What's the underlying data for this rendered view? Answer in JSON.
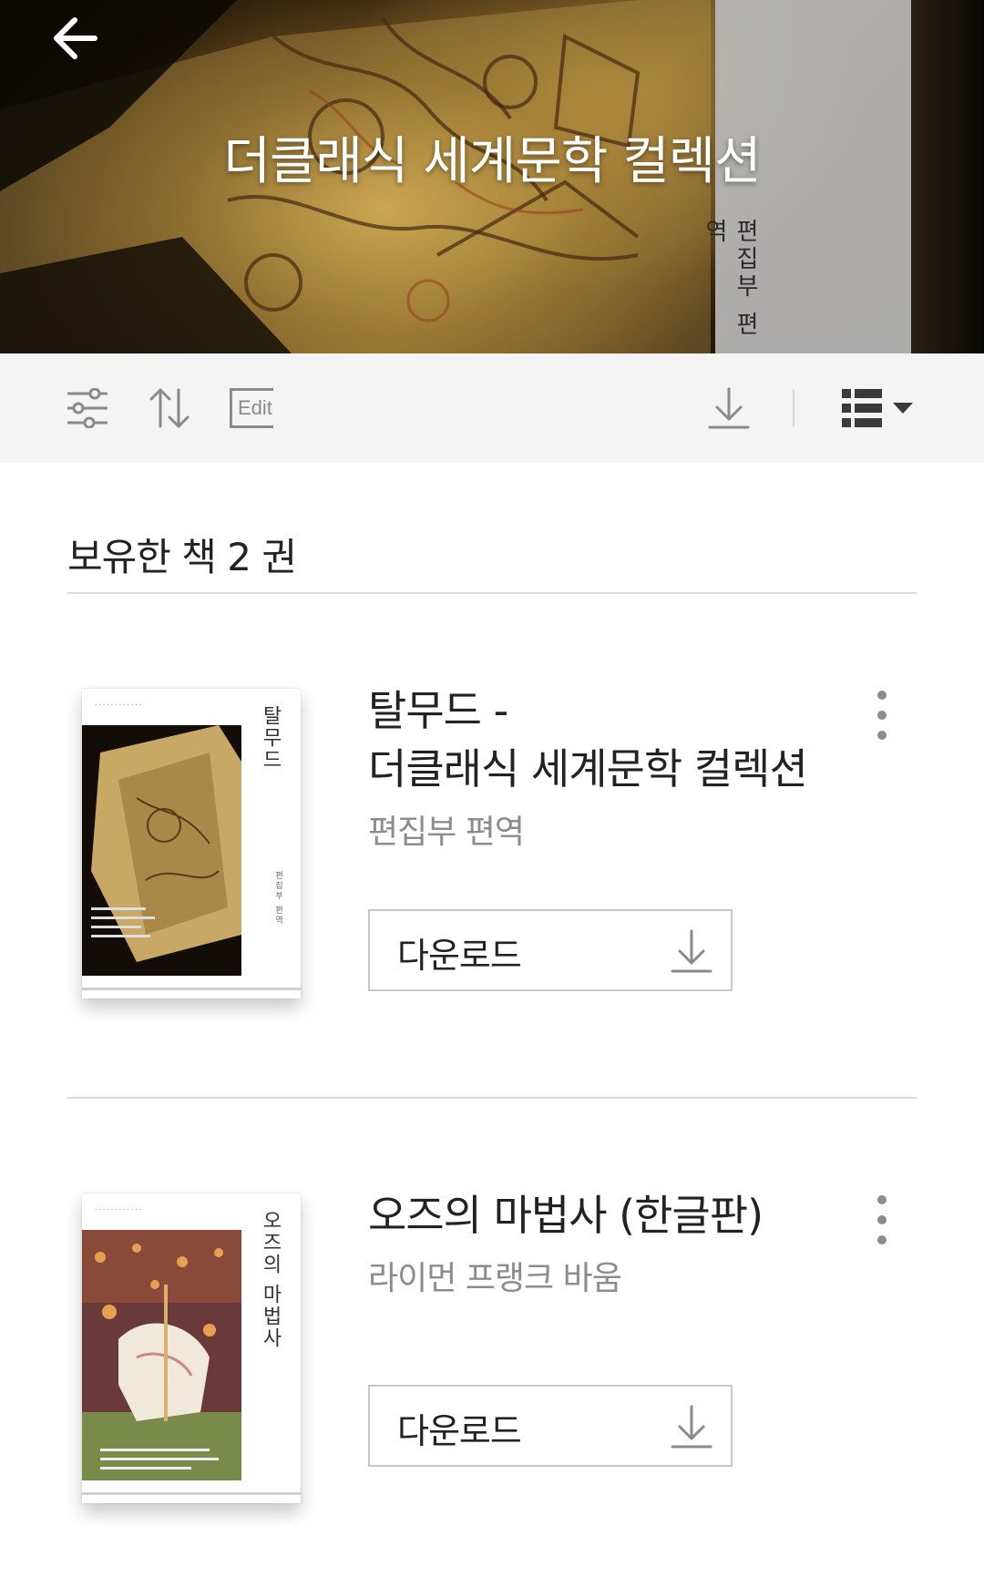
{
  "header": {
    "title": "더클래식 세계문학 컬렉션",
    "cover_strip_text": "편집부 편역"
  },
  "toolbar": {
    "filter_icon": "sliders-icon",
    "sort_icon": "sort-arrows-icon",
    "edit_label": "Edit",
    "download_icon": "download-icon",
    "view_icon": "list-view-icon"
  },
  "section": {
    "owned_label": "보유한 책 2 권"
  },
  "books": [
    {
      "title": "탈무드 -\n 더클래식 세계문학 컬렉션",
      "author": "편집부 편역",
      "download_label": "다운로드",
      "cover_title": "탈무드",
      "cover_subtitle": "편집부 편역"
    },
    {
      "title": "오즈의 마법사 (한글판)",
      "author": "라이먼 프랭크 바움",
      "download_label": "다운로드",
      "cover_title": "오즈의 마법사"
    }
  ],
  "colors": {
    "toolbar_bg": "#f4f4f4",
    "icon_gray": "#8a8a8a",
    "text_dark": "#222222",
    "text_muted": "#8c8c8c",
    "divider": "#d9d9d9"
  }
}
